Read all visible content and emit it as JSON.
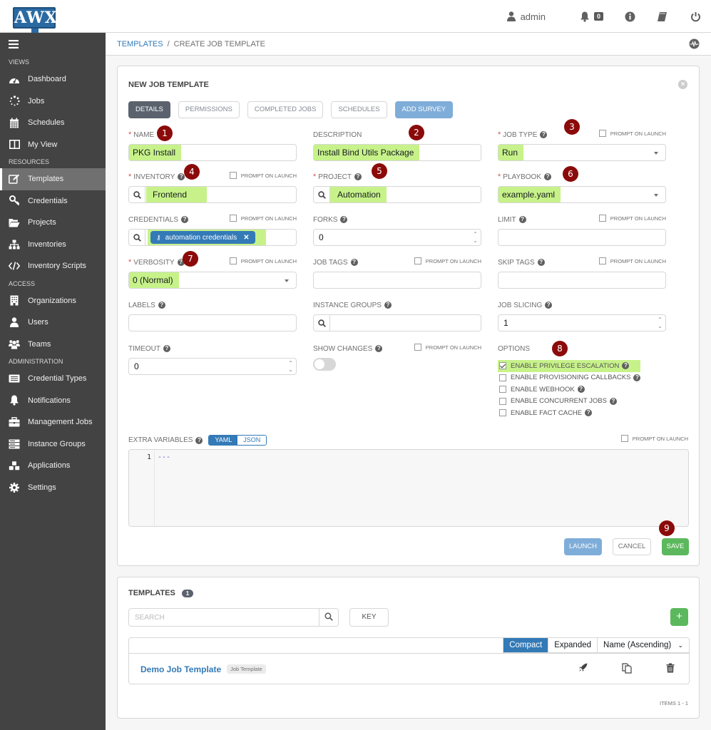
{
  "app": {
    "logo_text": "AWX"
  },
  "topbar": {
    "user": "admin",
    "notifications_count": "0",
    "icons": [
      "user-icon",
      "bell-icon",
      "info-icon",
      "book-icon",
      "power-icon"
    ]
  },
  "sidebar": {
    "sections": [
      {
        "heading": "VIEWS",
        "items": [
          {
            "label": "Dashboard",
            "icon": "dashboard-icon"
          },
          {
            "label": "Jobs",
            "icon": "jobs-icon"
          },
          {
            "label": "Schedules",
            "icon": "calendar-icon"
          },
          {
            "label": "My View",
            "icon": "columns-icon"
          }
        ]
      },
      {
        "heading": "RESOURCES",
        "items": [
          {
            "label": "Templates",
            "icon": "edit-icon",
            "active": true
          },
          {
            "label": "Credentials",
            "icon": "key-icon"
          },
          {
            "label": "Projects",
            "icon": "folder-icon"
          },
          {
            "label": "Inventories",
            "icon": "sitemap-icon"
          },
          {
            "label": "Inventory Scripts",
            "icon": "code-icon"
          }
        ]
      },
      {
        "heading": "ACCESS",
        "items": [
          {
            "label": "Organizations",
            "icon": "building-icon"
          },
          {
            "label": "Users",
            "icon": "user-icon"
          },
          {
            "label": "Teams",
            "icon": "users-icon"
          }
        ]
      },
      {
        "heading": "ADMINISTRATION",
        "items": [
          {
            "label": "Credential Types",
            "icon": "list-alt-icon"
          },
          {
            "label": "Notifications",
            "icon": "bell-icon"
          },
          {
            "label": "Management Jobs",
            "icon": "briefcase-icon"
          },
          {
            "label": "Instance Groups",
            "icon": "server-icon"
          },
          {
            "label": "Applications",
            "icon": "cubes-icon"
          },
          {
            "label": "Settings",
            "icon": "cog-icon"
          }
        ]
      }
    ]
  },
  "breadcrumb": {
    "parent": "TEMPLATES",
    "separator": "/",
    "current": "CREATE JOB TEMPLATE"
  },
  "form": {
    "title": "NEW JOB TEMPLATE",
    "tabs": [
      "DETAILS",
      "PERMISSIONS",
      "COMPLETED JOBS",
      "SCHEDULES",
      "ADD SURVEY"
    ],
    "prompt_on_launch": "PROMPT ON LAUNCH",
    "fields": {
      "name": {
        "label": "NAME",
        "value": "PKG Install",
        "required": true
      },
      "description": {
        "label": "DESCRIPTION",
        "value": "Install Bind Utils Package"
      },
      "job_type": {
        "label": "JOB TYPE",
        "value": "Run",
        "required": true
      },
      "inventory": {
        "label": "INVENTORY",
        "value": "Frontend",
        "required": true
      },
      "project": {
        "label": "PROJECT",
        "value": "Automation",
        "required": true
      },
      "playbook": {
        "label": "PLAYBOOK",
        "value": "example.yaml",
        "required": true
      },
      "credentials": {
        "label": "CREDENTIALS",
        "chip": "automation credentials"
      },
      "forks": {
        "label": "FORKS",
        "value": "0"
      },
      "limit": {
        "label": "LIMIT",
        "value": ""
      },
      "verbosity": {
        "label": "VERBOSITY",
        "value": "0 (Normal)",
        "required": true
      },
      "job_tags": {
        "label": "JOB TAGS",
        "value": ""
      },
      "skip_tags": {
        "label": "SKIP TAGS",
        "value": ""
      },
      "labels": {
        "label": "LABELS",
        "value": ""
      },
      "instance_groups": {
        "label": "INSTANCE GROUPS",
        "value": ""
      },
      "job_slicing": {
        "label": "JOB SLICING",
        "value": "1"
      },
      "timeout": {
        "label": "TIMEOUT",
        "value": "0"
      },
      "show_changes": {
        "label": "SHOW CHANGES",
        "on": false
      }
    },
    "options": {
      "label": "OPTIONS",
      "items": [
        {
          "label": "ENABLE PRIVILEGE ESCALATION",
          "checked": true
        },
        {
          "label": "ENABLE PROVISIONING CALLBACKS",
          "checked": false
        },
        {
          "label": "ENABLE WEBHOOK",
          "checked": false
        },
        {
          "label": "ENABLE CONCURRENT JOBS",
          "checked": false
        },
        {
          "label": "ENABLE FACT CACHE",
          "checked": false
        }
      ]
    },
    "extra_variables": {
      "label": "EXTRA VARIABLES",
      "modes": [
        "YAML",
        "JSON"
      ],
      "active_mode": "YAML",
      "line_number": "1",
      "content": "---"
    },
    "buttons": {
      "launch": "LAUNCH",
      "cancel": "CANCEL",
      "save": "SAVE"
    },
    "annotations": [
      "1",
      "2",
      "3",
      "4",
      "5",
      "6",
      "7",
      "8",
      "9"
    ]
  },
  "templates_list": {
    "title": "TEMPLATES",
    "count": "1",
    "search_placeholder": "SEARCH",
    "key_label": "KEY",
    "add_label": "+",
    "views": [
      "Compact",
      "Expanded"
    ],
    "active_view": "Compact",
    "sort": "Name (Ascending)",
    "rows": [
      {
        "name": "Demo Job Template",
        "type": "Job Template"
      }
    ],
    "items_label": "ITEMS  1 - 1"
  },
  "colors": {
    "accent": "#337ab7",
    "sidebar": "#434343",
    "highlight": "#c7f28a",
    "annotation": "#8b0a0a",
    "save": "#5cb85c"
  }
}
